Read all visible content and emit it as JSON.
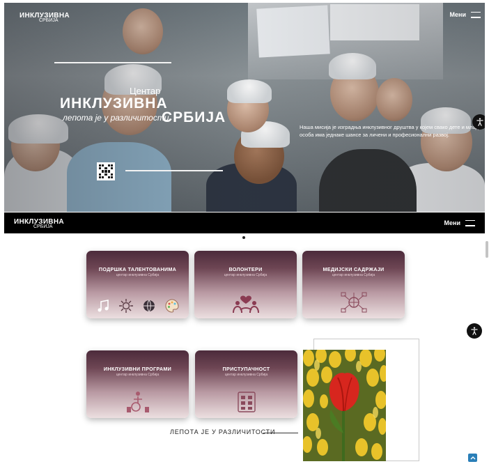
{
  "hero": {
    "logo_line1": "ИНКЛУЗИВНА",
    "logo_line2": "СРБИЈА",
    "menu_label": "Мени",
    "title_centar": "Центар",
    "title_main": "ИНКЛУЗИВНА",
    "title_motto": "лепота је у различитости",
    "title_srbija": "СРБИЈА",
    "description": "Наша мисија је изградња инклузивног друштва у којем свако дете и млада особа има једнаке шансе за личени и професионални развој."
  },
  "navbar": {
    "logo_line1": "ИНКЛУЗИВНА",
    "logo_line2": "СРБИЈА",
    "menu_label": "Мени"
  },
  "cards": [
    {
      "title": "ПОДРШКА ТАЛЕНТОВАНИМА",
      "subtitle": "центар инклузивна Србија",
      "icons": [
        "music-icon",
        "sun-icon",
        "globe-icon",
        "palette-icon"
      ]
    },
    {
      "title": "ВОЛОНТЕРИ",
      "subtitle": "центар инклузивна Србија",
      "icons": [
        "volunteers-heart-icon"
      ]
    },
    {
      "title": "МЕДИЈСКИ САДРЖАЈИ",
      "subtitle": "центар инклузивна Србија",
      "icons": [
        "media-network-icon"
      ]
    },
    {
      "title": "ИНКЛУЗИВНИ ПРОГРАМИ",
      "subtitle": "центар инклузивна Србија",
      "icons": [
        "inclusion-icon"
      ]
    },
    {
      "title": "ПРИСТУПАЧНОСТ",
      "subtitle": "центар инклузивна Србија",
      "icons": [
        "accessibility-board-icon"
      ]
    }
  ],
  "motto_footer": "ЛЕПОТА ЈЕ У РАЗЛИЧИТОСТИ",
  "colors": {
    "card_top": "#4c2b3b",
    "card_bottom": "#ecdfe0",
    "navbar": "#000000",
    "to_top_button": "#2a7fb8"
  }
}
